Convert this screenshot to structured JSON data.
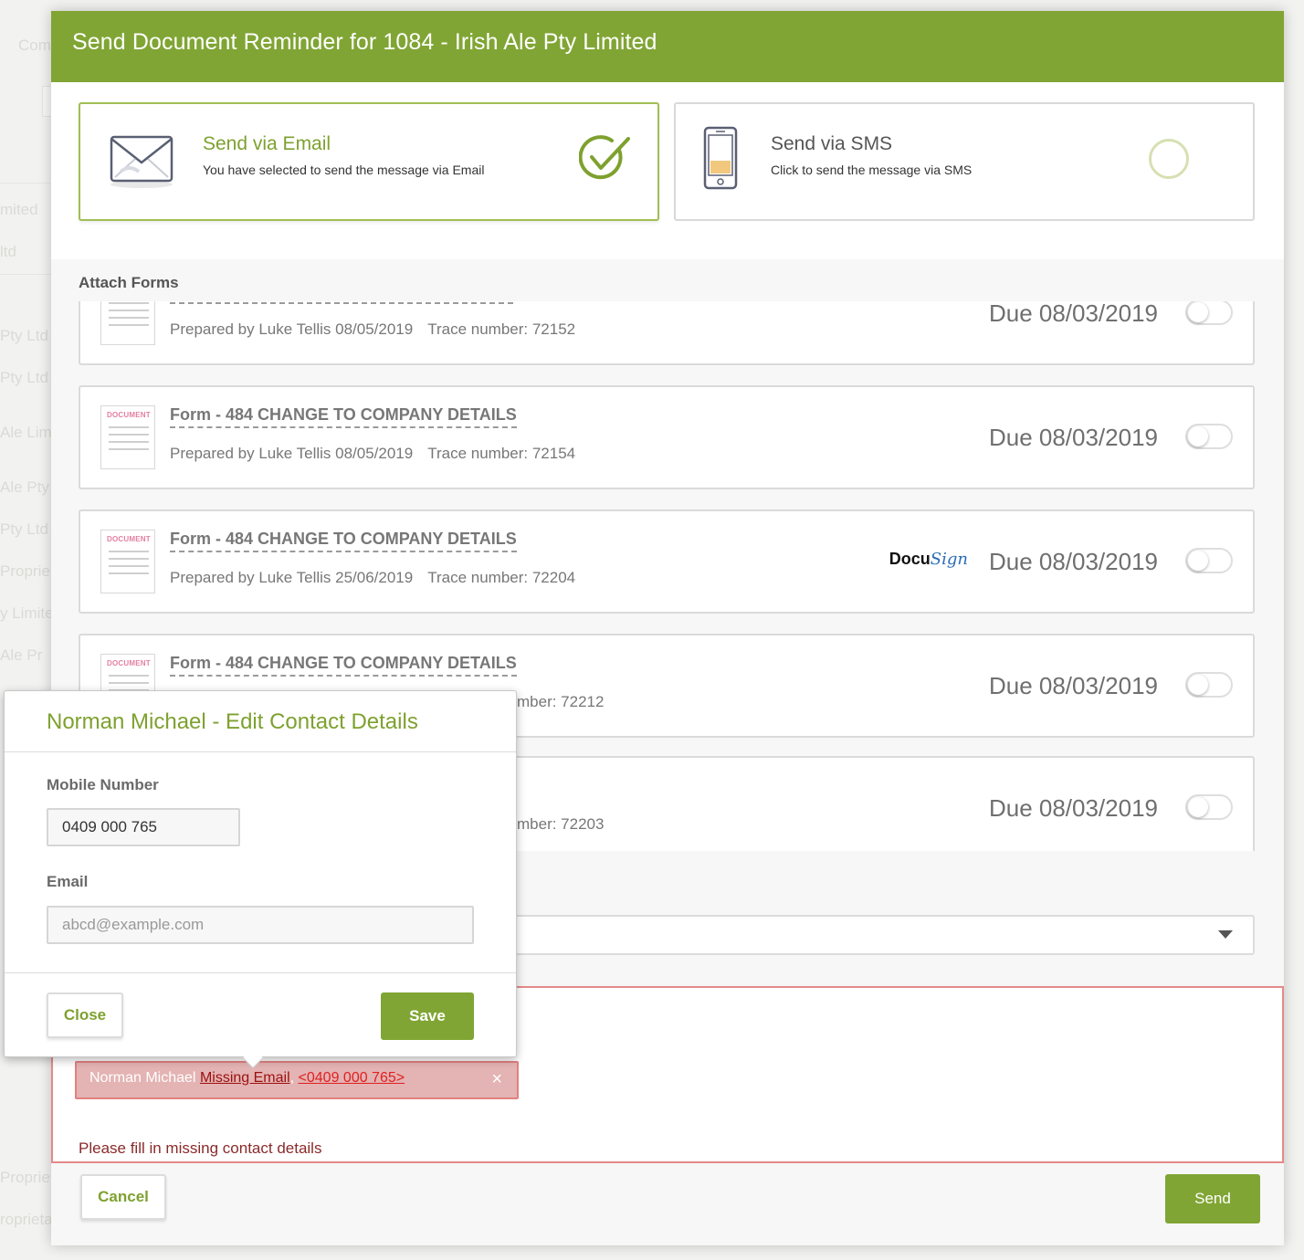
{
  "background": {
    "header_fragment": "Com",
    "list_fragments": [
      "mited",
      "ltd",
      "Pty Ltd",
      "Pty Ltd",
      "Ale Lim",
      "Ale Pty",
      "Pty Ltd",
      "Proprie",
      "y Limite",
      "Ale Pr",
      "Proprie",
      "roprieta"
    ]
  },
  "modal": {
    "title": "Send Document Reminder for 1084 - Irish Ale Pty Limited",
    "channels": {
      "email": {
        "title": "Send via Email",
        "description": "You have selected to send the message via Email",
        "selected": true,
        "icon": "envelope-icon"
      },
      "sms": {
        "title": "Send via SMS",
        "description": "Click to send the message via SMS",
        "selected": false,
        "icon": "phone-icon"
      }
    },
    "attach_forms_label": "Attach Forms",
    "forms": [
      {
        "title": "",
        "prepared": "Prepared by Luke Tellis 08/05/2019",
        "trace": "Trace number: 72152",
        "due": "Due 08/03/2019",
        "attached": false,
        "docusign": false
      },
      {
        "title": "Form - 484 CHANGE TO COMPANY DETAILS",
        "prepared": "Prepared by Luke Tellis 08/05/2019",
        "trace": "Trace number: 72154",
        "due": "Due 08/03/2019",
        "attached": false,
        "docusign": false
      },
      {
        "title": "Form - 484 CHANGE TO COMPANY DETAILS",
        "prepared": "Prepared by Luke Tellis 25/06/2019",
        "trace": "Trace number: 72204",
        "due": "Due 08/03/2019",
        "attached": false,
        "docusign": true
      },
      {
        "title": "Form - 484 CHANGE TO COMPANY DETAILS",
        "prepared": "",
        "trace": "mber: 72212",
        "due": "Due 08/03/2019",
        "attached": false,
        "docusign": false
      },
      {
        "title": "",
        "prepared": "",
        "trace": "mber: 72203",
        "due": "Due 08/03/2019",
        "attached": false,
        "docusign": false
      }
    ],
    "doc_thumb_label": "DOCUMENT",
    "docusign": {
      "docu": "Docu",
      "sign": "Sign"
    },
    "contact_tag": {
      "name": "Norman Michael",
      "missing": "Missing Email",
      "separator": ",",
      "phone": "<0409 000 765>",
      "remove": "×"
    },
    "error_message": "Please fill in missing contact details",
    "cancel_label": "Cancel",
    "send_label": "Send"
  },
  "popover": {
    "title": "Norman Michael - Edit Contact Details",
    "mobile_label": "Mobile Number",
    "mobile_value": "0409 000 765",
    "email_label": "Email",
    "email_placeholder": "abcd@example.com",
    "close_label": "Close",
    "save_label": "Save"
  }
}
